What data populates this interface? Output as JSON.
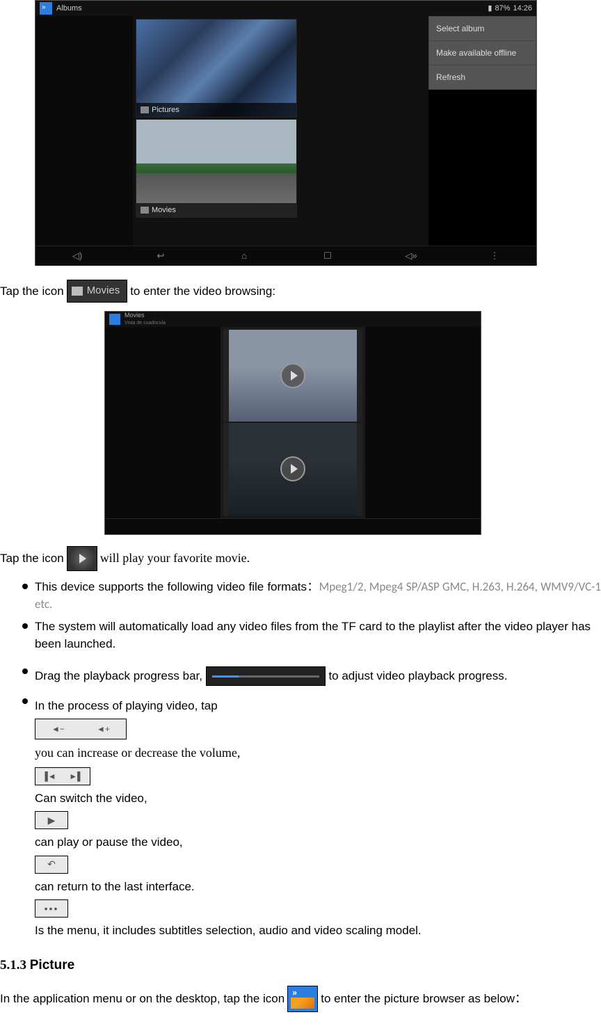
{
  "screenshot1": {
    "title": "Albums",
    "battery": "87%",
    "time": "14:26",
    "thumbs": [
      "Pictures",
      "Movies"
    ],
    "menu": [
      "Select album",
      "Make available offline",
      "Refresh"
    ]
  },
  "para1_a": "Tap the icon",
  "movies_label": "Movies",
  "para1_b": "to enter the video browsing:",
  "screenshot2": {
    "title": "Movies",
    "subtitle": "Vista de cuadricula"
  },
  "para2_a": "Tap the icon",
  "para2_b": "will play your favorite movie.",
  "bullets": {
    "b1_a": "This device supports the following video file formats：",
    "b1_b": "Mpeg1/2, Mpeg4 SP/ASP GMC, H.263, H.264, WMV9/VC-1 etc.",
    "b2": "The system will automatically load any video files from the TF card to the playlist after the video player has been launched.",
    "b3_a": "Drag  the  playback  progress  bar,",
    "b3_b": "to  adjust  video  playback progress.",
    "b4_a": "In  the  process  of  playing  video,  tap",
    "b4_b": "you  can  increase  or  decrease  the volume,",
    "b4_c": "Can  switch  the  video",
    "b4_c2": ",",
    "b4_d": "can  play  or  pause  the  video,",
    "b4_e": "can  return  to  the  last  interface.",
    "b4_f": "Is  the  menu,  it  includes  subtitles selection, audio and video scaling model."
  },
  "heading": {
    "num": "5.1.3 ",
    "title": "Picture"
  },
  "para3_a": "In the application menu or on the desktop, tap the icon",
  "para3_b": "to enter the picture browser as below：",
  "icons": {
    "vol_minus": "◄−",
    "vol_plus": "◄+",
    "prev": "▐◄",
    "next": "►▌",
    "play": "▶",
    "return": "↶",
    "menu": "•••"
  }
}
